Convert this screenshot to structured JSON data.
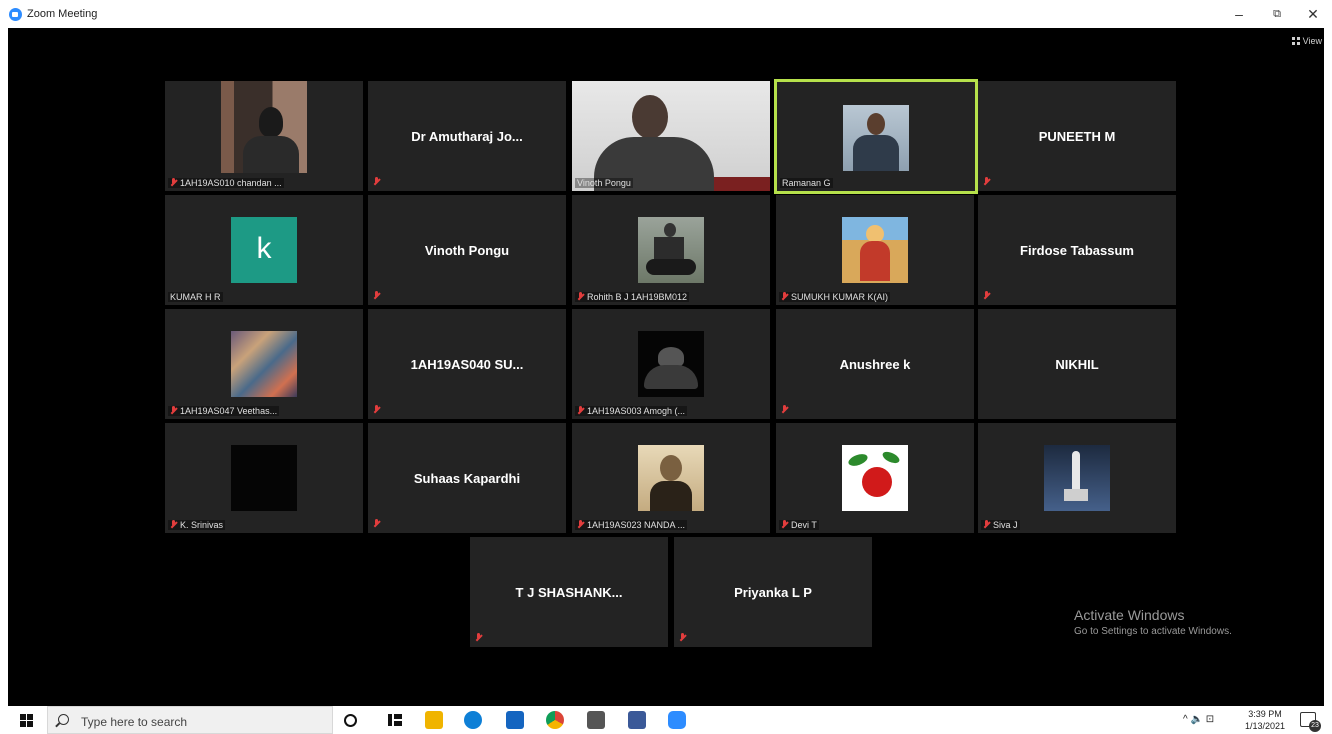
{
  "window": {
    "title": "Zoom Meeting"
  },
  "controls": {
    "minimize": "–",
    "restore": "⧉",
    "close": "✕",
    "view": "View"
  },
  "tiles": [
    {
      "label": "1AH19AS010 chandan ...",
      "muted": true
    },
    {
      "name": "Dr Amutharaj Jo...",
      "muted": true
    },
    {
      "label": "Vinoth Pongu",
      "muted": false
    },
    {
      "label": "Ramanan G",
      "muted": false,
      "active": true
    },
    {
      "name": "PUNEETH M",
      "muted": true
    },
    {
      "label": "KUMAR H R",
      "muted": false,
      "initial": "k"
    },
    {
      "name": "Vinoth Pongu",
      "muted": true
    },
    {
      "label": "Rohith B J 1AH19BM012",
      "muted": true
    },
    {
      "label": "SUMUKH KUMAR K(AI)",
      "muted": true
    },
    {
      "name": "Firdose Tabassum",
      "muted": true
    },
    {
      "label": "1AH19AS047 Veethas...",
      "muted": true
    },
    {
      "name": "1AH19AS040 SU...",
      "muted": true
    },
    {
      "label": "1AH19AS003 Amogh (...",
      "muted": true
    },
    {
      "name": "Anushree k",
      "muted": true
    },
    {
      "name": "NIKHIL",
      "muted": false
    },
    {
      "label": "K. Srinivas",
      "muted": true
    },
    {
      "name": "Suhaas Kapardhi",
      "muted": true
    },
    {
      "label": "1AH19AS023 NANDA ...",
      "muted": true
    },
    {
      "label": "Devi T",
      "muted": true
    },
    {
      "label": "Siva J",
      "muted": true
    },
    {
      "name": "T J SHASHANK...",
      "muted": true
    },
    {
      "name": "Priyanka L P",
      "muted": true
    }
  ],
  "watermark": {
    "line1": "Activate Windows",
    "line2": "Go to Settings to activate Windows."
  },
  "taskbar": {
    "search_placeholder": "Type here to search",
    "time": "3:39 PM",
    "date": "1/13/2021",
    "tray_text": "^ 🔈 ⊡",
    "notifications": "23"
  },
  "colors": {
    "tile": "#232323",
    "active_border": "#b6e14b",
    "avatar_k": "#1d9a85"
  }
}
